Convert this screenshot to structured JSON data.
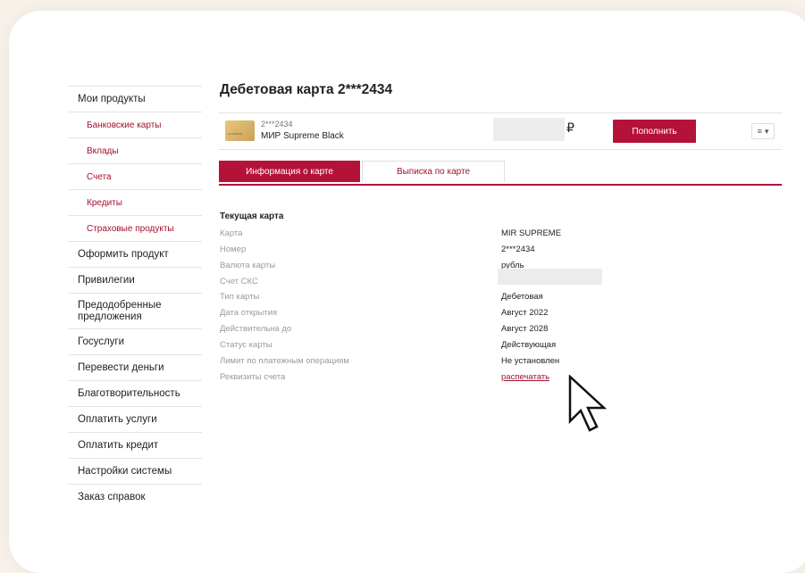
{
  "sidebar": {
    "items": [
      {
        "label": "Мои продукты",
        "sub": false
      },
      {
        "label": "Банковские карты",
        "sub": true
      },
      {
        "label": "Вклады",
        "sub": true
      },
      {
        "label": "Счета",
        "sub": true
      },
      {
        "label": "Кредиты",
        "sub": true
      },
      {
        "label": "Страховые продукты",
        "sub": true
      },
      {
        "label": "Оформить продукт",
        "sub": false
      },
      {
        "label": "Привилегии",
        "sub": false
      },
      {
        "label": "Предодобренные предложения",
        "sub": false
      },
      {
        "label": "Госуслуги",
        "sub": false
      },
      {
        "label": "Перевести деньги",
        "sub": false
      },
      {
        "label": "Благотворительность",
        "sub": false
      },
      {
        "label": "Оплатить услуги",
        "sub": false
      },
      {
        "label": "Оплатить кредит",
        "sub": false
      },
      {
        "label": "Настройки системы",
        "sub": false
      },
      {
        "label": "Заказ справок",
        "sub": false
      }
    ]
  },
  "page": {
    "title": "Дебетовая карта 2***2434"
  },
  "product": {
    "number": "2***2434",
    "name": "МИР Supreme Black",
    "currency_symbol": "₽",
    "topup_label": "Пополнить",
    "menu_icon": "list-icon",
    "thumb_text": "SUPREME"
  },
  "tabs": [
    {
      "label": "Информация о карте",
      "active": true
    },
    {
      "label": "Выписка по карте",
      "active": false
    }
  ],
  "info": {
    "section_title": "Текущая карта",
    "rows": [
      {
        "label": "Карта",
        "value": "MIR SUPREME"
      },
      {
        "label": "Номер",
        "value": "2***2434"
      },
      {
        "label": "Валюта карты",
        "value": "рубль"
      },
      {
        "label": "Счет СКС",
        "value": ""
      },
      {
        "label": "Тип карты",
        "value": "Дебетовая"
      },
      {
        "label": "Дата открытия",
        "value": "Август 2022"
      },
      {
        "label": "Действительна до",
        "value": "Август 2028"
      },
      {
        "label": "Статус карты",
        "value": "Действующая"
      },
      {
        "label": "Лимит по платежным операциям",
        "value": "Не установлен"
      },
      {
        "label": "Реквизиты счета",
        "value": "распечатать"
      }
    ]
  },
  "colors": {
    "brand": "#b5123a",
    "link": "#a3112e",
    "background": "#f7f1ea"
  }
}
